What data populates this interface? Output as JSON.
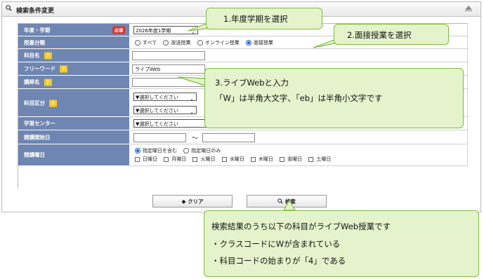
{
  "panel": {
    "title": "検索条件変更"
  },
  "form": {
    "year_term": {
      "label": "年度・学期",
      "required": "必須",
      "value": "2026年度1学期"
    },
    "class_type": {
      "label": "授業分類",
      "options": [
        "すべて",
        "放送授業",
        "オンライン授業",
        "面接授業"
      ],
      "selected": "面接授業"
    },
    "subject_name": {
      "label": "科目名",
      "help": "?",
      "value": ""
    },
    "free_word": {
      "label": "フリーワード",
      "help": "?",
      "value": "ライブWeb"
    },
    "lecturer": {
      "label": "講師名",
      "help": "?",
      "value": ""
    },
    "subject_category": {
      "label": "科目区分",
      "help": "?",
      "select1": "▼選択してください",
      "select2": "▼選択してください"
    },
    "learning_center": {
      "label": "学習センター",
      "value": "▼選択してください"
    },
    "start_date": {
      "label": "開講開始日",
      "from": "",
      "separator": "～",
      "to": ""
    },
    "weekday": {
      "label": "開講曜日",
      "modes": [
        "指定曜日を含む",
        "指定曜日のみ"
      ],
      "selected_mode": "指定曜日を含む",
      "days": [
        "日曜日",
        "月曜日",
        "火曜日",
        "水曜日",
        "木曜日",
        "金曜日",
        "土曜日"
      ]
    }
  },
  "buttons": {
    "clear": "クリア",
    "search": "検索"
  },
  "callouts": {
    "c1": "1.年度学期を選択",
    "c2": "2.面接授業を選択",
    "c3_line1": "3.ライブWebと入力",
    "c3_line2": "「W」は半角大文字、「eb」は半角小文字です",
    "c4_line1": "検索結果のうち以下の科目がライブWeb授業です",
    "c4_line2": "・クラスコードにWが含まれている",
    "c4_line3": "・科目コードの始まりが「4」である"
  },
  "colors": {
    "label_bg": "#6f86b2",
    "callout_bg": "#e4f3cc",
    "callout_border": "#7dbd3e",
    "required_badge": "#d9362e",
    "help_badge": "#f3c92c"
  }
}
